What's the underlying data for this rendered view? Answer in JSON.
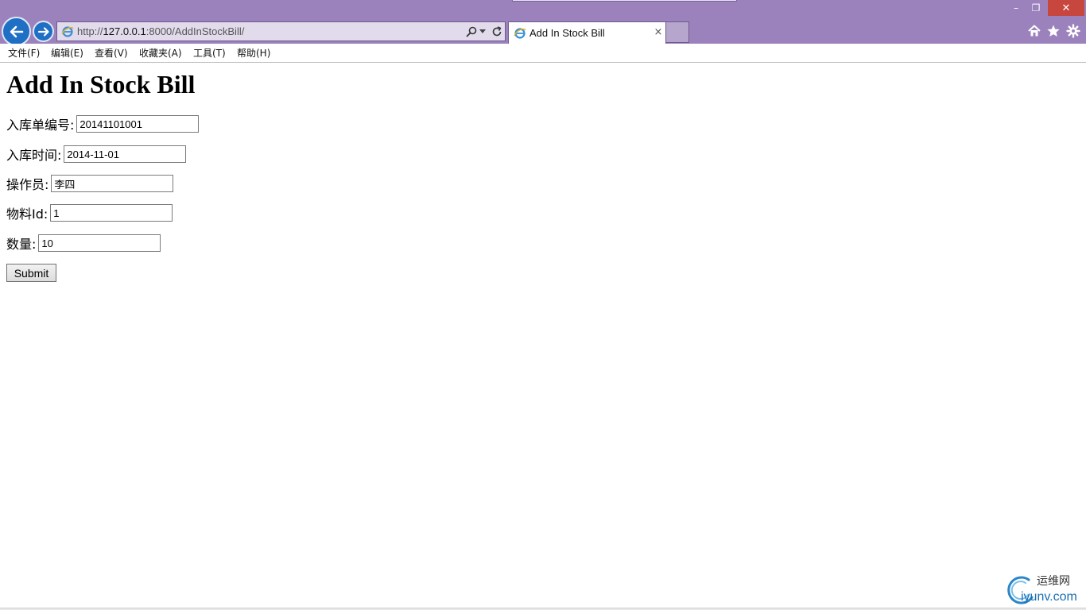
{
  "browser": {
    "url_prefix": "http://",
    "url_host": "127.0.0.1",
    "url_rest": ":8000/AddInStockBill/",
    "tab_title": "Add In Stock Bill",
    "tab_close_glyph": "×",
    "window_min": "–",
    "window_restore": "❐",
    "window_close": "✕",
    "colors": {
      "frame": "#9c82bd",
      "nav_button": "#1f6fc5",
      "close_button": "#c7463e"
    }
  },
  "menu": {
    "items": [
      "文件(F)",
      "编辑(E)",
      "查看(V)",
      "收藏夹(A)",
      "工具(T)",
      "帮助(H)"
    ]
  },
  "page": {
    "title": "Add In Stock Bill",
    "fields": [
      {
        "label": "入库单编号:",
        "value": "20141101001"
      },
      {
        "label": "入库时间:",
        "value": "2014-11-01"
      },
      {
        "label": "操作员:",
        "value": "李四"
      },
      {
        "label": "物料Id:",
        "value": "1"
      },
      {
        "label": "数量:",
        "value": "10"
      }
    ],
    "submit_label": "Submit"
  },
  "watermark": {
    "line1": "运维网",
    "line2": "iyunv.com"
  }
}
